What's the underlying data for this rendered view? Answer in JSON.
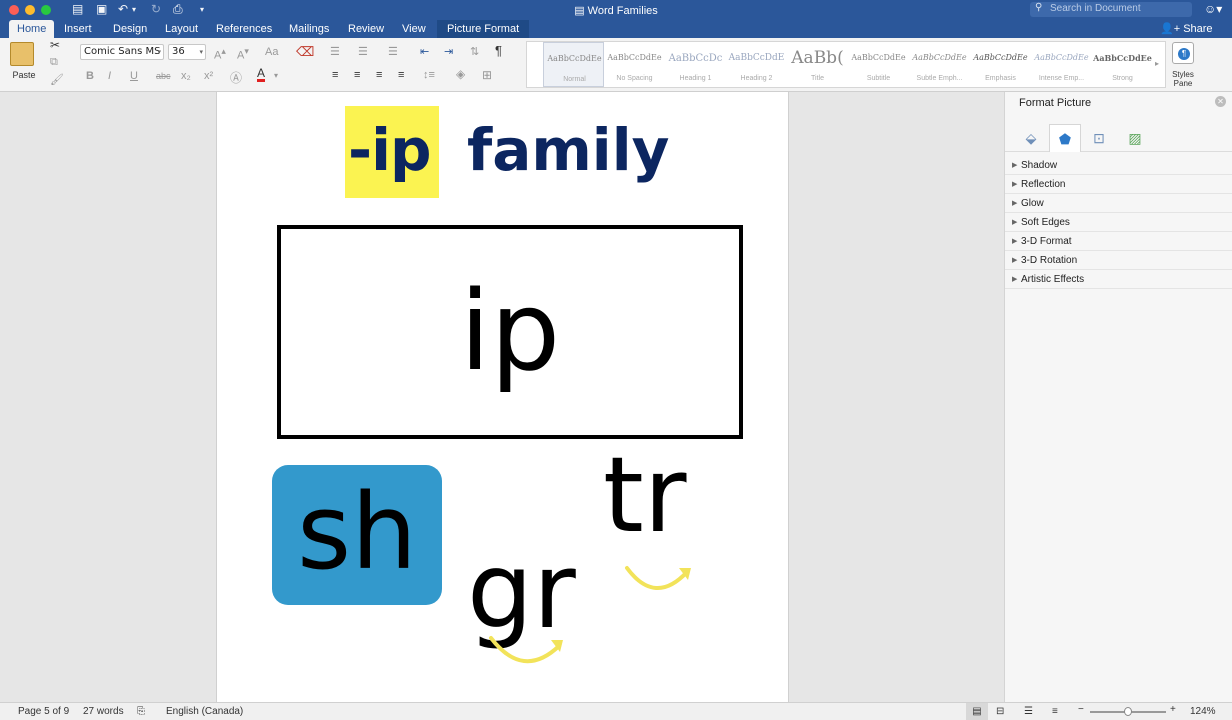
{
  "window": {
    "title": "Word Families",
    "search_placeholder": "Search in Document",
    "share_label": "Share"
  },
  "tabs": [
    {
      "label": "Home",
      "active": true
    },
    {
      "label": "Insert"
    },
    {
      "label": "Design"
    },
    {
      "label": "Layout"
    },
    {
      "label": "References"
    },
    {
      "label": "Mailings"
    },
    {
      "label": "Review"
    },
    {
      "label": "View"
    },
    {
      "label": "Picture Format",
      "contextual": true
    }
  ],
  "ribbon": {
    "paste_label": "Paste",
    "font_name": "Comic Sans MS",
    "font_size": "36",
    "styles_pane_label": "Styles Pane",
    "styles": [
      {
        "sample": "AaBbCcDdEe",
        "name": "Normal"
      },
      {
        "sample": "AaBbCcDdEe",
        "name": "No Spacing"
      },
      {
        "sample": "AaBbCcDc",
        "name": "Heading 1"
      },
      {
        "sample": "AaBbCcDdE",
        "name": "Heading 2"
      },
      {
        "sample": "AaBb(",
        "name": "Title"
      },
      {
        "sample": "AaBbCcDdEe",
        "name": "Subtitle"
      },
      {
        "sample": "AaBbCcDdEe",
        "name": "Subtle Emph..."
      },
      {
        "sample": "AaBbCcDdEe",
        "name": "Emphasis"
      },
      {
        "sample": "AaBbCcDdEe",
        "name": "Intense Emp..."
      },
      {
        "sample": "AaBbCcDdEe",
        "name": "Strong"
      }
    ]
  },
  "document": {
    "title_highlight": "-ip",
    "title_word": "family",
    "box_word": "ip",
    "blends": [
      "sh",
      "tr",
      "gr"
    ],
    "colors": {
      "highlight": "#fbf351",
      "title_text": "#0c2660",
      "sh_box": "#3399cc",
      "arrow": "#f2e35a"
    }
  },
  "format_pane": {
    "title": "Format Picture",
    "icons": [
      "fill-line-icon",
      "effects-icon",
      "layout-properties-icon",
      "picture-icon"
    ],
    "sections": [
      "Shadow",
      "Reflection",
      "Glow",
      "Soft Edges",
      "3-D Format",
      "3-D Rotation",
      "Artistic Effects"
    ]
  },
  "status": {
    "page": "Page 5 of 9",
    "words": "27 words",
    "language": "English (Canada)",
    "zoom": "124%"
  }
}
